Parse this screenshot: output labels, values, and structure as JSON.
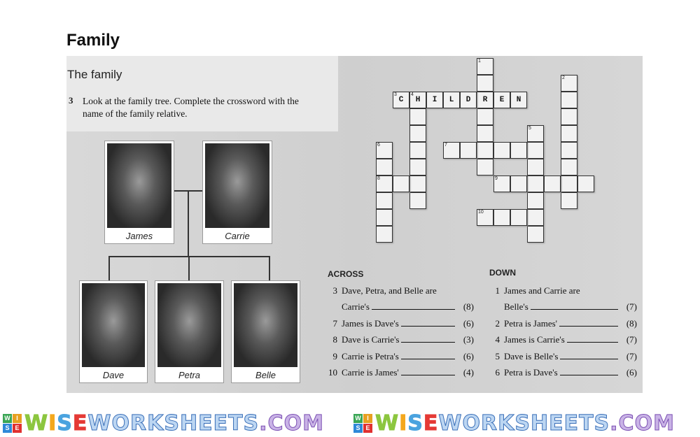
{
  "page_title": "Family",
  "section_title": "The family",
  "instruction": {
    "number": "3",
    "text": "Look at the family tree. Complete the crossword with the name of the family relative."
  },
  "family": {
    "parents": [
      "James",
      "Carrie"
    ],
    "children": [
      "Dave",
      "Petra",
      "Belle"
    ]
  },
  "crossword": {
    "entries": [
      {
        "number": "1",
        "direction": "down",
        "length": 7,
        "filled": ""
      },
      {
        "number": "2",
        "direction": "down",
        "length": 8,
        "filled": ""
      },
      {
        "number": "3",
        "direction": "across",
        "length": 8,
        "filled": "CHILDREN"
      },
      {
        "number": "4",
        "direction": "down",
        "length": 7,
        "filled": ""
      },
      {
        "number": "5",
        "direction": "down",
        "length": 7,
        "filled": ""
      },
      {
        "number": "6",
        "direction": "down",
        "length": 6,
        "filled": ""
      },
      {
        "number": "7",
        "direction": "across",
        "length": 6,
        "filled": ""
      },
      {
        "number": "8",
        "direction": "across",
        "length": 3,
        "filled": ""
      },
      {
        "number": "9",
        "direction": "across",
        "length": 6,
        "filled": ""
      },
      {
        "number": "10",
        "direction": "across",
        "length": 4,
        "filled": ""
      }
    ]
  },
  "clues": {
    "across_heading": "ACROSS",
    "down_heading": "DOWN",
    "across": [
      {
        "num": "3",
        "line1": "Dave, Petra, and Belle are",
        "line2": "Carrie's",
        "len": "(8)"
      },
      {
        "num": "7",
        "line1": "James is Dave's",
        "len": "(6)"
      },
      {
        "num": "8",
        "line1": "Dave is Carrie's",
        "len": "(3)"
      },
      {
        "num": "9",
        "line1": "Carrie is Petra's",
        "len": "(6)"
      },
      {
        "num": "10",
        "line1": "Carrie is James'",
        "len": "(4)"
      }
    ],
    "down": [
      {
        "num": "1",
        "line1": "James and Carrie are",
        "line2": "Belle's",
        "len": "(7)"
      },
      {
        "num": "2",
        "line1": "Petra is James'",
        "len": "(8)"
      },
      {
        "num": "4",
        "line1": "James is Carrie's",
        "len": "(7)"
      },
      {
        "num": "5",
        "line1": "Dave is Belle's",
        "len": "(7)"
      },
      {
        "num": "6",
        "line1": "Petra is Dave's",
        "len": "(6)"
      }
    ]
  },
  "footer": {
    "logo_box": [
      "W",
      "I",
      "S",
      "E"
    ],
    "logo_text": "WISEWORKSHEETS.COM",
    "logo_colors": [
      "#3aa655",
      "#e8a020",
      "#2e88d8",
      "#e03030"
    ]
  }
}
